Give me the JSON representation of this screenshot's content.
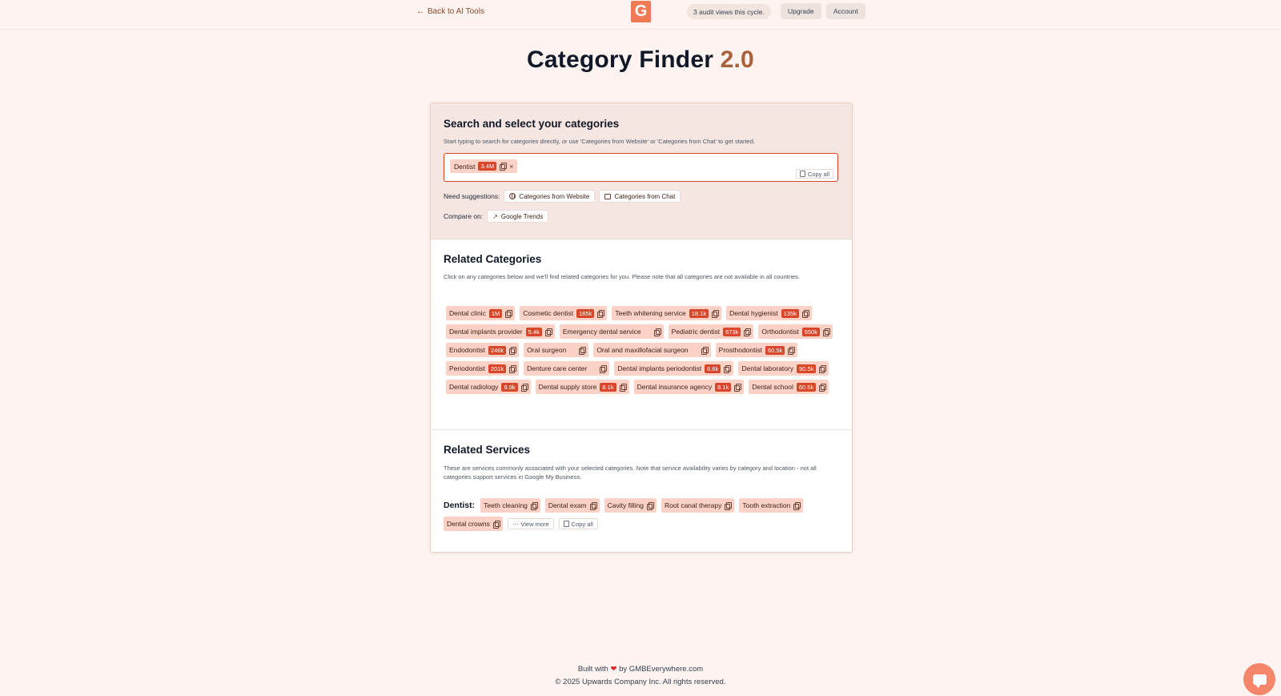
{
  "header": {
    "back_label": "Back to AI Tools",
    "logo_letter": "G",
    "audit_text": "3 audit views this cycle.",
    "upgrade_label": "Upgrade",
    "account_label": "Account"
  },
  "title": {
    "main": "Category Finder",
    "version": "2.0"
  },
  "search": {
    "heading": "Search and select your categories",
    "description": "Start typing to search for categories directly, or use 'Categories from Website' or 'Categories from Chat' to get started.",
    "selected": {
      "name": "Dentist",
      "count": "3.4M"
    },
    "copy_all_label": "Copy all",
    "suggest_label": "Need suggestions:",
    "website_btn": "Categories from Website",
    "chat_btn": "Categories from Chat",
    "compare_label": "Compare on:",
    "trends_btn": "Google Trends"
  },
  "related": {
    "heading": "Related Categories",
    "description": "Click on any categories below and we'll find related categories for you. Please note that all categories are not available in all countries.",
    "items": [
      {
        "name": "Dental clinic",
        "count": "1M"
      },
      {
        "name": "Cosmetic dentist",
        "count": "165k"
      },
      {
        "name": "Teeth whitening service",
        "count": "18.1k"
      },
      {
        "name": "Dental hygienist",
        "count": "135k"
      },
      {
        "name": "Dental implants provider",
        "count": "5.4k"
      },
      {
        "name": "Emergency dental service",
        "count": ""
      },
      {
        "name": "Pediatric dentist",
        "count": "673k"
      },
      {
        "name": "Orthodontist",
        "count": "550k"
      },
      {
        "name": "Endodontist",
        "count": "246k"
      },
      {
        "name": "Oral surgeon",
        "count": ""
      },
      {
        "name": "Oral and maxillofacial surgeon",
        "count": ""
      },
      {
        "name": "Prosthodontist",
        "count": "60.5k"
      },
      {
        "name": "Periodontist",
        "count": "201k"
      },
      {
        "name": "Denture care center",
        "count": ""
      },
      {
        "name": "Dental implants periodontist",
        "count": "6.6k"
      },
      {
        "name": "Dental laboratory",
        "count": "90.5k"
      },
      {
        "name": "Dental radiology",
        "count": "9.9k"
      },
      {
        "name": "Dental supply store",
        "count": "8.1k"
      },
      {
        "name": "Dental insurance agency",
        "count": "8.1k"
      },
      {
        "name": "Dental school",
        "count": "60.5k"
      }
    ]
  },
  "services": {
    "heading": "Related Services",
    "description": "These are services commonly associated with your selected categories. Note that service availability varies by category and location - not all categories support services in Google My Business.",
    "group_label": "Dentist:",
    "items": [
      "Teeth cleaning",
      "Dental exam",
      "Cavity filling",
      "Root canal therapy",
      "Tooth extraction",
      "Dental crowns"
    ],
    "view_more_label": "View more",
    "copy_all_label": "Copy all"
  },
  "footer": {
    "built_prefix": "Built with",
    "built_suffix": "by GMBEverywhere.com",
    "copyright": "© 2025 Upwards Company Inc. All rights reserved."
  },
  "colors": {
    "accent": "#d9472b",
    "chip_bg": "#fbd2c5",
    "page_bg": "#fdf3f0",
    "version": "#a8613a"
  }
}
